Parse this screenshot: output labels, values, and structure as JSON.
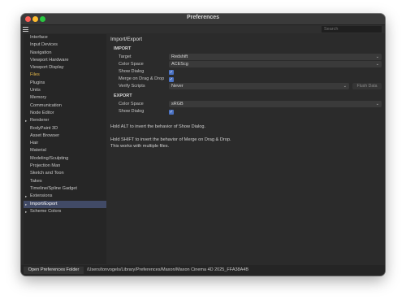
{
  "window": {
    "title": "Preferences"
  },
  "toolbar": {
    "search_placeholder": "Search"
  },
  "sidebar": {
    "items": [
      {
        "label": "Interface",
        "arrow": "",
        "state": ""
      },
      {
        "label": "Input Devices",
        "arrow": "",
        "state": ""
      },
      {
        "label": "Navigation",
        "arrow": "",
        "state": ""
      },
      {
        "label": "Viewport Hardware",
        "arrow": "",
        "state": ""
      },
      {
        "label": "Viewport Display",
        "arrow": "",
        "state": ""
      },
      {
        "label": "Files",
        "arrow": "",
        "state": "highlight"
      },
      {
        "label": "Plugins",
        "arrow": "",
        "state": ""
      },
      {
        "label": "Units",
        "arrow": "",
        "state": ""
      },
      {
        "label": "Memory",
        "arrow": "",
        "state": ""
      },
      {
        "label": "Communication",
        "arrow": "",
        "state": ""
      },
      {
        "label": "Node Editor",
        "arrow": "",
        "state": ""
      },
      {
        "label": "Renderer",
        "arrow": "▸",
        "state": ""
      },
      {
        "label": "BodyPaint 3D",
        "arrow": "",
        "state": ""
      },
      {
        "label": "Asset Browser",
        "arrow": "",
        "state": ""
      },
      {
        "label": "Hair",
        "arrow": "",
        "state": ""
      },
      {
        "label": "Material",
        "arrow": "",
        "state": ""
      },
      {
        "label": "Modeling/Sculpting",
        "arrow": "",
        "state": ""
      },
      {
        "label": "Projection Man",
        "arrow": "",
        "state": ""
      },
      {
        "label": "Sketch and Toon",
        "arrow": "",
        "state": ""
      },
      {
        "label": "Takes",
        "arrow": "",
        "state": ""
      },
      {
        "label": "Timeline/Spline Gadget",
        "arrow": "",
        "state": ""
      },
      {
        "label": "Extensions",
        "arrow": "▸",
        "state": ""
      },
      {
        "label": "Import/Export",
        "arrow": "▸",
        "state": "selected"
      },
      {
        "label": "Scheme Colors",
        "arrow": "▸",
        "state": ""
      }
    ]
  },
  "content": {
    "heading": "Import/Export",
    "import": {
      "section": "IMPORT",
      "target_label": "Target",
      "target_value": "Redshift",
      "color_space_label": "Color Space",
      "color_space_value": "ACEScg",
      "show_dialog_label": "Show Dialog",
      "show_dialog_checked": true,
      "merge_label": "Merge on Drag & Drop",
      "merge_checked": true,
      "verify_label": "Verify Scripts",
      "verify_value": "Never",
      "flush_label": "Flush Data"
    },
    "export": {
      "section": "EXPORT",
      "color_space_label": "Color Space",
      "color_space_value": "sRGB",
      "show_dialog_label": "Show Dialog",
      "show_dialog_checked": true
    },
    "notes": [
      "Hold ALT to invert the behavior of Show Dialog.",
      "Hold SHIFT to invert the behavior of Merge on Drag & Drop.",
      "This works with multiple files."
    ]
  },
  "footer": {
    "open_button": "Open Preferences Folder",
    "path": "/Users/tonvogels/Library/Preferences/Maxon/Maxon Cinema 4D 2025_FFA38A4B"
  },
  "colors": {
    "accent_selected": "#414a66",
    "highlight_text": "#e6b94a",
    "checkbox": "#4a72c4"
  }
}
